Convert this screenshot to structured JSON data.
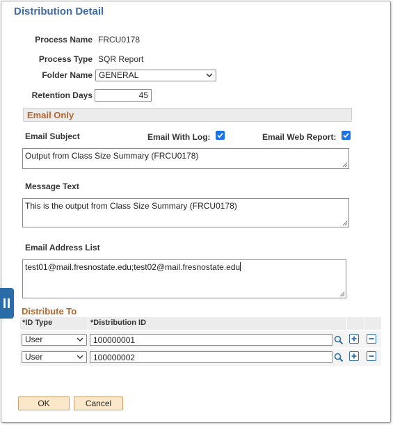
{
  "page": {
    "title": "Distribution Detail"
  },
  "fields": {
    "process_name_label": "Process Name",
    "process_name_value": "FRCU0178",
    "process_type_label": "Process Type",
    "process_type_value": "SQR Report",
    "folder_name_label": "Folder Name",
    "folder_name_value": "GENERAL",
    "retention_days_label": "Retention Days",
    "retention_days_value": "45"
  },
  "email": {
    "section_title": "Email Only",
    "subject_label": "Email Subject",
    "with_log_label": "Email With Log:",
    "with_log_checked": true,
    "web_report_label": "Email Web Report:",
    "web_report_checked": true,
    "subject_value": "Output from Class Size Summary (FRCU0178)",
    "message_label": "Message Text",
    "message_value": "This is the output from Class Size Summary (FRCU0178)",
    "address_label": "Email Address List",
    "address_value": "test01@mail.fresnostate.edu;test02@mail.fresnostate.edu"
  },
  "distribute": {
    "section_title": "Distribute To",
    "col_id_type": "*ID Type",
    "col_distribution_id": "*Distribution ID",
    "rows": [
      {
        "id_type": "User",
        "distribution_id": "100000001"
      },
      {
        "id_type": "User",
        "distribution_id": "100000002"
      }
    ]
  },
  "buttons": {
    "ok": "OK",
    "cancel": "Cancel"
  },
  "colors": {
    "title": "#3e6ba5",
    "section_header": "#b5652a",
    "checkbox": "#1a73e8",
    "button_fill": "#fbe7c9",
    "icon_blue": "#2f6fa7"
  },
  "icons": {
    "side_tab": "pause-icon",
    "lookup": "magnifier-icon",
    "add_row": "plus-icon",
    "delete_row": "minus-icon",
    "dropdown": "chevron-down-icon"
  }
}
